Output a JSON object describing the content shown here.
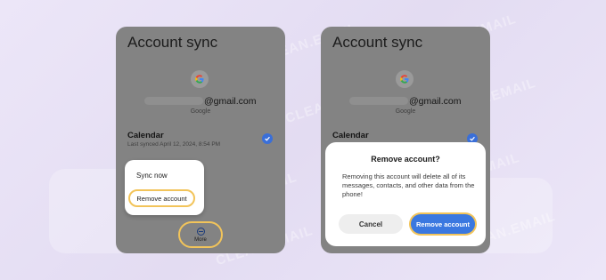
{
  "watermark": "CLEAN.EMAIL",
  "left_screen": {
    "title": "Account sync",
    "google_icon": "google-g-icon",
    "email_suffix": "@gmail.com",
    "account_provider": "Google",
    "sync_item": {
      "title": "Calendar",
      "last_synced": "Last synced April 12, 2024, 8:54 PM",
      "checked": true
    },
    "menu": {
      "sync_now": "Sync now",
      "remove_account": "Remove account"
    },
    "more_button": {
      "label": "More",
      "icon": "minus-circle-icon"
    }
  },
  "right_screen": {
    "title": "Account sync",
    "google_icon": "google-g-icon",
    "email_suffix": "@gmail.com",
    "account_provider": "Google",
    "sync_item": {
      "title": "Calendar",
      "checked": true
    },
    "dialog": {
      "title": "Remove account?",
      "message": "Removing this account will delete all of its messages, contacts, and other data from the phone!",
      "cancel_label": "Cancel",
      "confirm_label": "Remove account"
    }
  },
  "colors": {
    "highlight": "#f2c45a",
    "accent_blue": "#3a78e0",
    "overlay_gray": "#838383"
  }
}
